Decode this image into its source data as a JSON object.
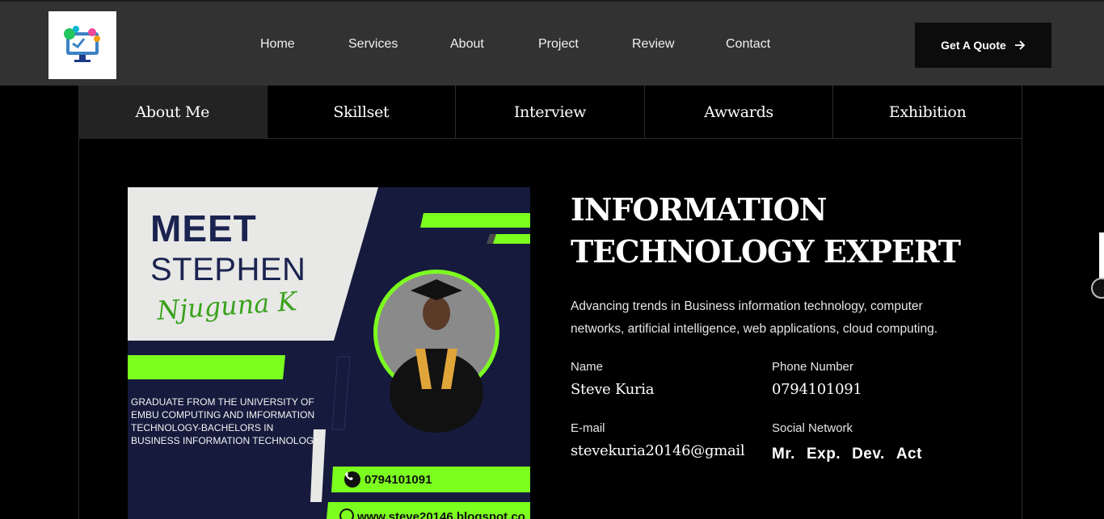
{
  "header": {
    "nav": [
      {
        "label": "Home"
      },
      {
        "label": "Services"
      },
      {
        "label": "About"
      },
      {
        "label": "Project"
      },
      {
        "label": "Review"
      },
      {
        "label": "Contact"
      }
    ],
    "cta_label": "Get A Quote"
  },
  "tabs": [
    {
      "label": "About Me",
      "active": true
    },
    {
      "label": "Skillset"
    },
    {
      "label": "Interview"
    },
    {
      "label": "Awwards"
    },
    {
      "label": "Exhibition"
    }
  ],
  "poster": {
    "meet": "MEET",
    "name": "STEPHEN",
    "signature": "Njuguna K",
    "graduate_text": "GRADUATE FROM THE UNIVERSITY OF EMBU COMPUTING AND IMFORMATION TECHNOLOGY-BACHELORS IN BUSINESS INFORMATION TECHNOLOGY.",
    "phone": "0794101091",
    "website": "www.steve20146.blogspot.co"
  },
  "profile": {
    "headline": "INFORMATION TECHNOLOGY EXPERT",
    "description": "Advancing trends in Business information technology, computer networks, artificial intelligence, web applications, cloud computing.",
    "name_label": "Name",
    "name_value": "Steve Kuria",
    "phone_label": "Phone Number",
    "phone_value": "0794101091",
    "email_label": "E-mail",
    "email_value": "stevekuria20146@gmail",
    "social_label": "Social Network",
    "social_links": [
      {
        "label": "Mr."
      },
      {
        "label": "Exp."
      },
      {
        "label": "Dev."
      },
      {
        "label": "Act"
      }
    ]
  },
  "colors": {
    "header_bg": "#323232",
    "page_bg": "#000000",
    "active_tab_bg": "#232323",
    "poster_accent_green": "#7cff1f",
    "poster_navy": "#161b3d"
  },
  "icons": {
    "cta_icon": "arrow-right-icon",
    "phone_icon": "phone-icon",
    "web_icon": "globe-icon"
  }
}
